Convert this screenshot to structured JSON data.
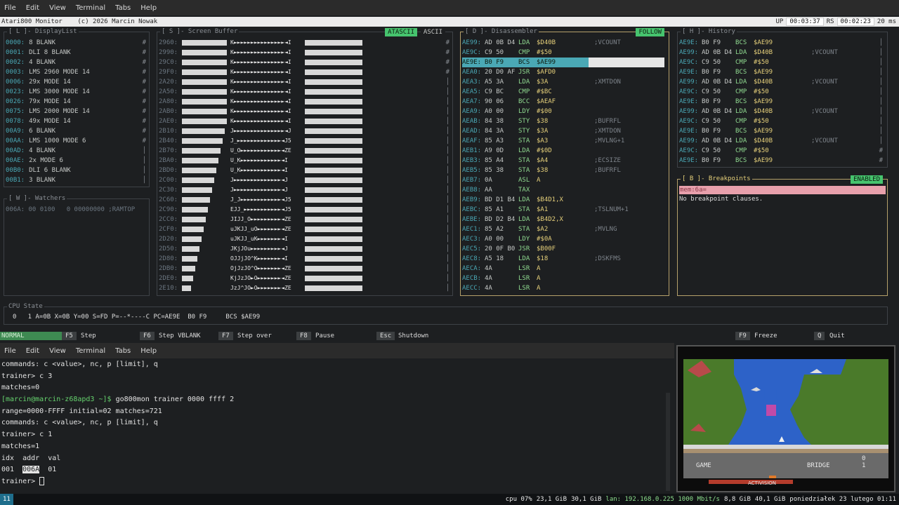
{
  "top_menu": {
    "file": "File",
    "edit": "Edit",
    "view": "View",
    "terminal": "Terminal",
    "tabs": "Tabs",
    "help": "Help"
  },
  "title": {
    "text": "Atari800 Monitor    (c) 2026 Marcin Nowak",
    "up_label": "UP",
    "up_value": "00:03:37",
    "rs_label": "RS",
    "rs_value": "00:02:23",
    "ms": "20 ms"
  },
  "displaylist": {
    "title": "[ L ]- DisplayList",
    "rows": [
      {
        "a": "0000:",
        "t": "8 BLANK"
      },
      {
        "a": "0001:",
        "t": "DLI 8 BLANK"
      },
      {
        "a": "0002:",
        "t": "4 BLANK"
      },
      {
        "a": "0003:",
        "t": "LMS 2960 MODE 14"
      },
      {
        "a": "0006:",
        "t": "29x MODE 14"
      },
      {
        "a": "0023:",
        "t": "LMS 3000 MODE 14"
      },
      {
        "a": "0026:",
        "t": "79x MODE 14"
      },
      {
        "a": "0075:",
        "t": "LMS 2000 MODE 14"
      },
      {
        "a": "0078:",
        "t": "49x MODE 14"
      },
      {
        "a": "00A9:",
        "t": "6 BLANK"
      },
      {
        "a": "00AA:",
        "t": "LMS 1000 MODE 6"
      },
      {
        "a": "00AD:",
        "t": "4 BLANK"
      },
      {
        "a": "00AE:",
        "t": "2x MODE 6"
      },
      {
        "a": "00B0:",
        "t": "DLI 6 BLANK"
      },
      {
        "a": "00B1:",
        "t": "3 BLANK"
      }
    ]
  },
  "watchers": {
    "title": "[ W ]- Watchers",
    "row": "006A: 00 0100   0 00000000 ;RAMTOP"
  },
  "screenbuffer": {
    "title": "[ S ]- Screen Buffer",
    "mode_active": "ATASCII",
    "mode_other": "ASCII",
    "rows": [
      {
        "a": "2960:",
        "txt": "K►►►►►►►►►►►►►►►◄I"
      },
      {
        "a": "2990:",
        "txt": "K►►►►►►►►►►►►►►►◄I"
      },
      {
        "a": "29C0:",
        "txt": "K►►►►►►►►►►►►►►►◄I"
      },
      {
        "a": "29F0:",
        "txt": "K►►►►►►►►►►►►►►►◄I"
      },
      {
        "a": "2A20:",
        "txt": "K►►►►►►►►►►►►►►►◄I"
      },
      {
        "a": "2A50:",
        "txt": "K►►►►►►►►►►►►►►►◄I"
      },
      {
        "a": "2A80:",
        "txt": "K►►►►►►►►►►►►►►►◄I"
      },
      {
        "a": "2AB0:",
        "txt": "K►►►►►►►►►►►►►►►◄I"
      },
      {
        "a": "2AE0:",
        "txt": "K►►►►►►►►►►►►►►►◄I"
      },
      {
        "a": "2B10:",
        "txt": "J►►►►►►►►►►►►►►►◄J"
      },
      {
        "a": "2B40:",
        "txt": "J_►►►►►►►►►►►►►◄J5"
      },
      {
        "a": "2B70:",
        "txt": "U_O►►►►►►►►►►►►◄ZE"
      },
      {
        "a": "2BA0:",
        "txt": "U_K►►►►►►►►►►►►◄I"
      },
      {
        "a": "2BD0:",
        "txt": "U_K►►►►►►►►►►►►◄I"
      },
      {
        "a": "2C00:",
        "txt": "J►►►►►►►►►►►►►►◄J"
      },
      {
        "a": "2C30:",
        "txt": "J►►►►►►►►►►►►►►◄J"
      },
      {
        "a": "2C60:",
        "txt": "J_J►►►►►►►►►►►►◄J5"
      },
      {
        "a": "2C90:",
        "txt": "EJJ_►►►►►►►►►►►◄J5"
      },
      {
        "a": "2CC0:",
        "txt": "JIJJ_O►►►►►►►►►◄ZE"
      },
      {
        "a": "2CF0:",
        "txt": "uJKJJ_uO►►►►►►►◄ZE"
      },
      {
        "a": "2D20:",
        "txt": "uJKJJ_uK►►►►►►►◄I"
      },
      {
        "a": "2D50:",
        "txt": "JKjJOu►►►►►►►►►◄J"
      },
      {
        "a": "2D80:",
        "txt": "OJJjJO^K►►►►►►►◄I"
      },
      {
        "a": "2DB0:",
        "txt": "OjJzJO^O►►►►►►►◄ZE"
      },
      {
        "a": "2DE0:",
        "txt": "KjJzJO►O►►►►►►►◄ZE"
      },
      {
        "a": "2E10:",
        "txt": "JzJ^JO►O►►►►►►►◄ZE"
      }
    ]
  },
  "disasm": {
    "title": "[ D ]- Disassembler",
    "follow": "FOLLOW",
    "rows": [
      {
        "a": "AE99:",
        "b": "AD 0B D4",
        "m": "LDA",
        "o": "$D40B",
        "c": ";VCOUNT"
      },
      {
        "a": "AE9C:",
        "b": "C9 50",
        "m": "CMP",
        "o": "#$50",
        "c": ""
      },
      {
        "a": "AE9E:",
        "b": "B0 F9",
        "m": "BCS",
        "o": "$AE99",
        "c": ""
      },
      {
        "a": "AEA0:",
        "b": "20 D0 AF",
        "m": "JSR",
        "o": "$AFD0",
        "c": ""
      },
      {
        "a": "AEA3:",
        "b": "A5 3A",
        "m": "LDA",
        "o": "$3A",
        "c": ";XMTDON"
      },
      {
        "a": "AEA5:",
        "b": "C9 BC",
        "m": "CMP",
        "o": "#$BC",
        "c": ""
      },
      {
        "a": "AEA7:",
        "b": "90 06",
        "m": "BCC",
        "o": "$AEAF",
        "c": ""
      },
      {
        "a": "AEA9:",
        "b": "A0 00",
        "m": "LDY",
        "o": "#$00",
        "c": ""
      },
      {
        "a": "AEAB:",
        "b": "84 38",
        "m": "STY",
        "o": "$38",
        "c": ";BUFRFL"
      },
      {
        "a": "AEAD:",
        "b": "84 3A",
        "m": "STY",
        "o": "$3A",
        "c": ";XMTDON"
      },
      {
        "a": "AEAF:",
        "b": "85 A3",
        "m": "STA",
        "o": "$A3",
        "c": ";MVLNG+1"
      },
      {
        "a": "AEB1:",
        "b": "A9 0D",
        "m": "LDA",
        "o": "#$0D",
        "c": ""
      },
      {
        "a": "AEB3:",
        "b": "85 A4",
        "m": "STA",
        "o": "$A4",
        "c": ";ECSIZE"
      },
      {
        "a": "AEB5:",
        "b": "85 38",
        "m": "STA",
        "o": "$38",
        "c": ";BUFRFL"
      },
      {
        "a": "AEB7:",
        "b": "0A",
        "m": "ASL",
        "o": "A",
        "c": ""
      },
      {
        "a": "AEB8:",
        "b": "AA",
        "m": "TAX",
        "o": "",
        "c": ""
      },
      {
        "a": "AEB9:",
        "b": "BD D1 B4",
        "m": "LDA",
        "o": "$B4D1,X",
        "c": ""
      },
      {
        "a": "AEBC:",
        "b": "85 A1",
        "m": "STA",
        "o": "$A1",
        "c": ";TSLNUM+1"
      },
      {
        "a": "AEBE:",
        "b": "BD D2 B4",
        "m": "LDA",
        "o": "$B4D2,X",
        "c": ""
      },
      {
        "a": "AEC1:",
        "b": "85 A2",
        "m": "STA",
        "o": "$A2",
        "c": ";MVLNG"
      },
      {
        "a": "AEC3:",
        "b": "A0 00",
        "m": "LDY",
        "o": "#$0A",
        "c": ""
      },
      {
        "a": "AEC5:",
        "b": "20 0F B0",
        "m": "JSR",
        "o": "$B00F",
        "c": ""
      },
      {
        "a": "AEC8:",
        "b": "A5 18",
        "m": "LDA",
        "o": "$18",
        "c": ";DSKFMS"
      },
      {
        "a": "AECA:",
        "b": "4A",
        "m": "LSR",
        "o": "A",
        "c": ""
      },
      {
        "a": "AECB:",
        "b": "4A",
        "m": "LSR",
        "o": "A",
        "c": ""
      },
      {
        "a": "AECC:",
        "b": "4A",
        "m": "LSR",
        "o": "A",
        "c": ""
      }
    ]
  },
  "history": {
    "title": "[ H ]- History",
    "rows": [
      {
        "a": "AE9E:",
        "b": "B0 F9",
        "m": "BCS",
        "o": "$AE99",
        "c": ""
      },
      {
        "a": "AE99:",
        "b": "AD 0B D4",
        "m": "LDA",
        "o": "$D40B",
        "c": ";VCOUNT"
      },
      {
        "a": "AE9C:",
        "b": "C9 50",
        "m": "CMP",
        "o": "#$50",
        "c": ""
      },
      {
        "a": "AE9E:",
        "b": "B0 F9",
        "m": "BCS",
        "o": "$AE99",
        "c": ""
      },
      {
        "a": "AE99:",
        "b": "AD 0B D4",
        "m": "LDA",
        "o": "$D40B",
        "c": ";VCOUNT"
      },
      {
        "a": "AE9C:",
        "b": "C9 50",
        "m": "CMP",
        "o": "#$50",
        "c": ""
      },
      {
        "a": "AE9E:",
        "b": "B0 F9",
        "m": "BCS",
        "o": "$AE99",
        "c": ""
      },
      {
        "a": "AE99:",
        "b": "AD 0B D4",
        "m": "LDA",
        "o": "$D40B",
        "c": ";VCOUNT"
      },
      {
        "a": "AE9C:",
        "b": "C9 50",
        "m": "CMP",
        "o": "#$50",
        "c": ""
      },
      {
        "a": "AE9E:",
        "b": "B0 F9",
        "m": "BCS",
        "o": "$AE99",
        "c": ""
      },
      {
        "a": "AE99:",
        "b": "AD 0B D4",
        "m": "LDA",
        "o": "$D40B",
        "c": ";VCOUNT"
      },
      {
        "a": "AE9C:",
        "b": "C9 50",
        "m": "CMP",
        "o": "#$50",
        "c": ""
      },
      {
        "a": "AE9E:",
        "b": "B0 F9",
        "m": "BCS",
        "o": "$AE99",
        "c": ""
      }
    ]
  },
  "breakpoints": {
    "title": "[ B ]- Breakpoints",
    "status": "ENABLED",
    "input": "mem:6a=",
    "empty": "No breakpoint clauses."
  },
  "cpu": {
    "title": "CPU State",
    "line": "0   1 A=0B X=0B Y=00 S=FD P=--*----C PC=AE9E  B0 F9     BCS $AE99"
  },
  "keys": {
    "mode": "NORMAL",
    "f5": "F5",
    "f5l": "Step",
    "f6": "F6",
    "f6l": "Step VBLANK",
    "f7": "F7",
    "f7l": "Step over",
    "f8": "F8",
    "f8l": "Pause",
    "esc": "Esc",
    "escl": "Shutdown",
    "f9": "F9",
    "f9l": "Freeze",
    "q": "Q",
    "ql": "Quit"
  },
  "term_menu": {
    "file": "File",
    "edit": "Edit",
    "view": "View",
    "terminal": "Terminal",
    "tabs": "Tabs",
    "help": "Help"
  },
  "terminal": {
    "l1": "commands: c <value>, nc, p [limit], q",
    "l2": "trainer> c 3",
    "l3": "matches=0",
    "user": "[marcin@marcin-z68apd3 ~]$",
    "cmd": " go800mon trainer 0000 ffff 2",
    "l5": "range=0000-FFFF initial=02 matches=721",
    "l6": "commands: c <value>, nc, p [limit], q",
    "l7": "trainer> c 1",
    "l8": "matches=1",
    "l9": "idx  addr  val",
    "r_idx": "001  ",
    "r_addr": "006A",
    "r_val": "  01",
    "prompt": "trainer> "
  },
  "game": {
    "score": "0",
    "label": "BRIDGE",
    "game_no": "1",
    "brand": "ACTIVISION"
  },
  "status": {
    "ws": "11",
    "cpu": "cpu 07%",
    "mem": "23,1 GiB",
    "disk": "30,1 GiB",
    "lan": "lan: 192.168.0.225 1000 Mbit/s",
    "ram": "8,8 GiB",
    "swap": "40,1 GiB",
    "date": "poniedziałek 23 lutego 01:11"
  },
  "colors": {
    "accent": "#46c46e",
    "highlight": "#4aa8b5",
    "breakpoint_bg": "#e8a0ac"
  }
}
